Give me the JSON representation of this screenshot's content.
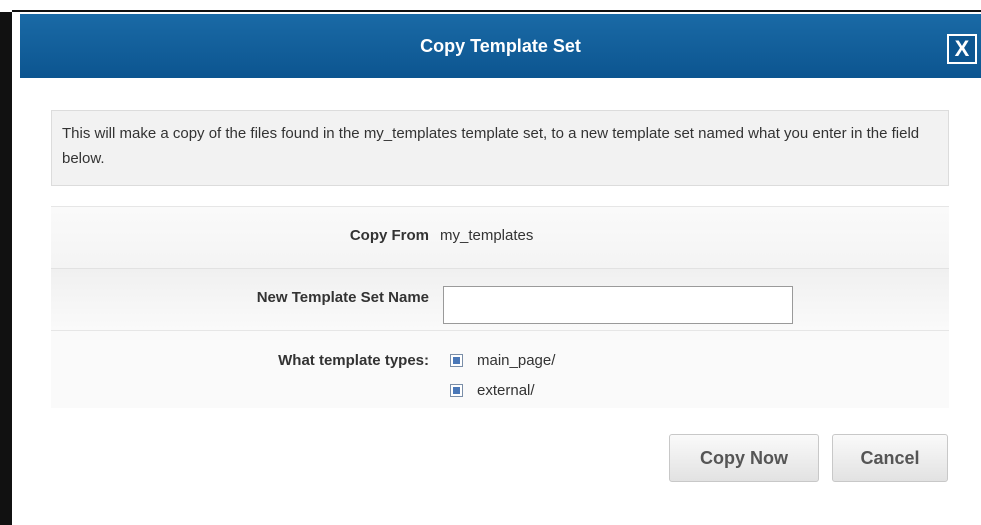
{
  "dialog": {
    "title": "Copy Template Set",
    "close_label": "X",
    "info_text": "This will make a copy of the files found in the my_templates template set, to a new template set named what you enter in the field below.",
    "fields": {
      "copy_from_label": "Copy From",
      "copy_from_value": "my_templates",
      "new_name_label": "New Template Set Name",
      "new_name_value": "",
      "types_label": "What template types:",
      "types": [
        {
          "label": "main_page/",
          "checked": true
        },
        {
          "label": "external/",
          "checked": true
        }
      ]
    },
    "buttons": {
      "copy_now": "Copy Now",
      "cancel": "Cancel"
    }
  },
  "colors": {
    "titlebar": "#0c5590",
    "checkbox_accent": "#4a78b8"
  }
}
